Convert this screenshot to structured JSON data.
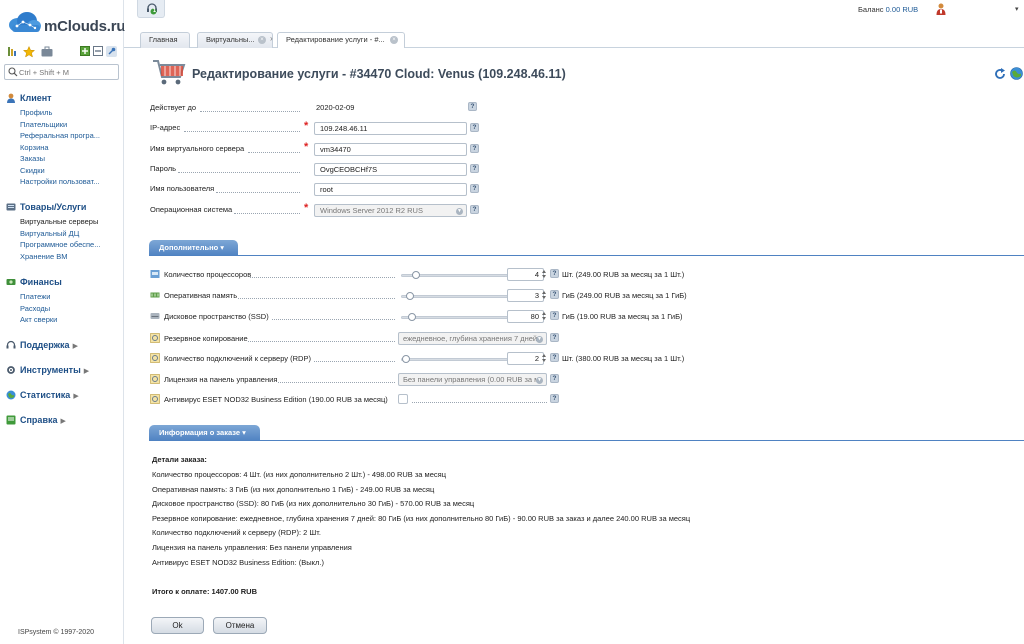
{
  "app": {
    "brand": "mClouds.ru",
    "copyright": "ISPsystem © 1997-2020"
  },
  "sidebar": {
    "search_placeholder": "Ctrl + Shift + M",
    "groups": [
      {
        "title": "Клиент",
        "items": [
          "Профиль",
          "Плательщики",
          "Реферальная програ...",
          "Корзина",
          "Заказы",
          "Скидки",
          "Настройки пользоват..."
        ]
      },
      {
        "title": "Товары/Услуги",
        "items": [
          "Виртуальные серверы",
          "Виртуальный ДЦ",
          "Программное обеспе...",
          "Хранение ВМ"
        ],
        "active_index": 0
      },
      {
        "title": "Финансы",
        "items": [
          "Платежи",
          "Расходы",
          "Акт сверки"
        ]
      },
      {
        "title": "Поддержка"
      },
      {
        "title": "Инструменты"
      },
      {
        "title": "Статистика"
      },
      {
        "title": "Справка"
      }
    ]
  },
  "topbar": {
    "balance_label": "Баланс",
    "balance_value": "0.00 RUB",
    "notification_count": "1"
  },
  "tabs": [
    {
      "label": "Главная"
    },
    {
      "label": "Виртуальны..."
    },
    {
      "label": "Редактирование услуги - #..."
    }
  ],
  "page": {
    "title": "Редактирование услуги - #34470 Cloud: Venus (109.248.46.11)"
  },
  "form": {
    "valid_until_label": "Действует до",
    "valid_until_value": "2020-02-09",
    "ip_label": "IP-адрес",
    "ip_value": "109.248.46.11",
    "vm_name_label": "Имя виртуального сервера",
    "vm_name_value": "vm34470",
    "password_label": "Пароль",
    "password_value": "OvgCEOBCHf7S",
    "username_label": "Имя пользователя",
    "username_value": "root",
    "os_label": "Операционная система",
    "os_value": "Windows Server 2012 R2 RUS",
    "help_glyph": "?",
    "required_mark": "*"
  },
  "extra": {
    "section_title": "Дополнительно",
    "cpu": {
      "label": "Количество процессоров",
      "value": "4",
      "price": "Шт. (249.00 RUB за месяц за 1 Шт.)",
      "slider_fraction": 0.12
    },
    "ram": {
      "label": "Оперативная память",
      "value": "3",
      "price": "ГиБ (249.00 RUB за месяц за 1 ГиБ)",
      "slider_fraction": 0.06
    },
    "disk": {
      "label": "Дисковое пространство (SSD)",
      "value": "80",
      "price": "ГиБ (19.00 RUB за месяц за 1 ГиБ)",
      "slider_fraction": 0.08
    },
    "backup": {
      "label": "Резервное копирование",
      "value": "ежедневное, глубина хранения 7 дней"
    },
    "rdp": {
      "label": "Количество подключений к серверу (RDP)",
      "value": "2",
      "price": "Шт. (380.00 RUB за месяц за 1 Шт.)",
      "slider_fraction": 0.02
    },
    "license": {
      "label": "Лицензия на панель управления",
      "value": "Без панели управления (0.00 RUB за м"
    },
    "antivirus": {
      "label": "Антивирус ESET NOD32 Business Edition (190.00 RUB за месяц)",
      "checked": false
    }
  },
  "order": {
    "section_title": "Информация о заказе",
    "details_title": "Детали заказа:",
    "lines": [
      "Количество процессоров: 4 Шт. (из них дополнительно 2 Шт.) - 498.00 RUB за месяц",
      "Оперативная память: 3 ГиБ (из них дополнительно 1 ГиБ) - 249.00 RUB за месяц",
      "Дисковое пространство (SSD): 80 ГиБ (из них дополнительно 30 ГиБ) - 570.00 RUB за месяц",
      "Резервное копирование: ежедневное, глубина хранения 7 дней: 80 ГиБ (из них дополнительно 80 ГиБ) - 90.00 RUB за заказ и далее 240.00 RUB за месяц",
      "Количество подключений к серверу (RDP): 2 Шт.",
      "Лицензия на панель управления: Без панели управления",
      "Антивирус ESET NOD32 Business Edition: (Выкл.)"
    ],
    "total": "Итого к оплате: 1407.00 RUB"
  },
  "buttons": {
    "ok": "Ok",
    "cancel": "Отмена"
  },
  "colors": {
    "accent": "#4f82c2",
    "link": "#1e5a96",
    "required": "#dd2222"
  }
}
